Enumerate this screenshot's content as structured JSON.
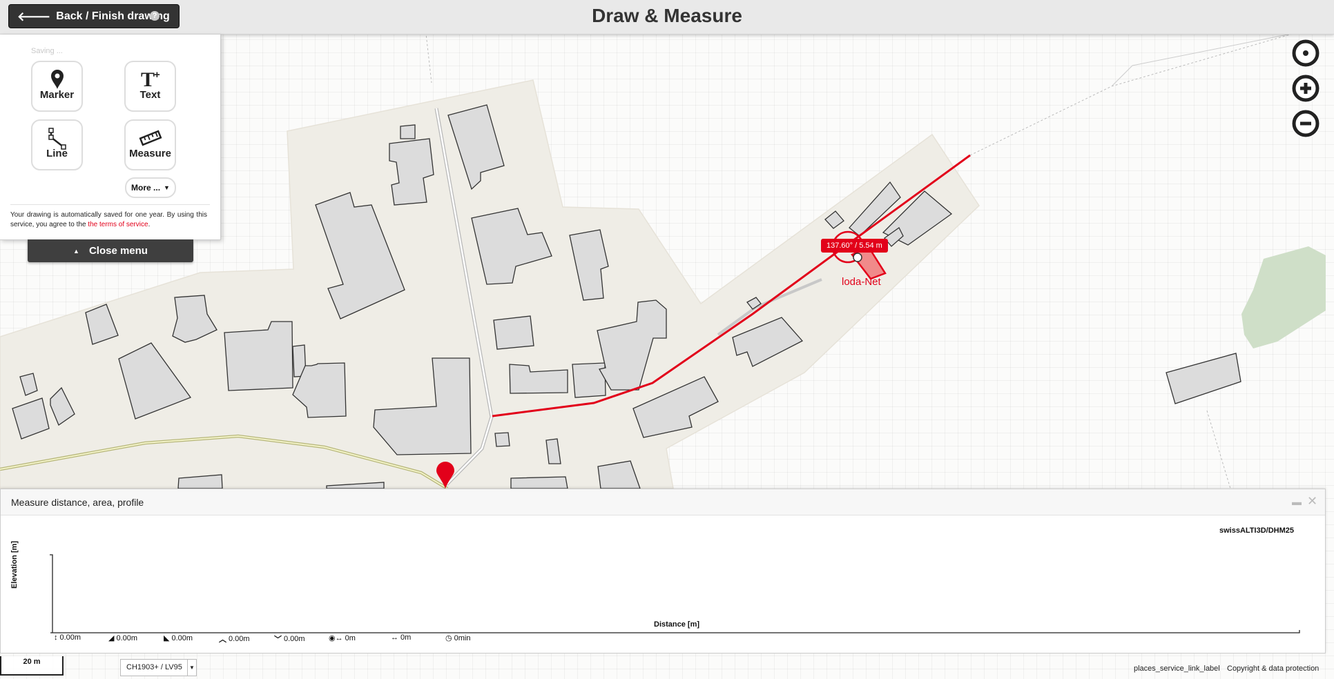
{
  "header": {
    "back_label": "Back / Finish drawing",
    "title": "Draw & Measure",
    "help_icon": "?"
  },
  "draw_menu": {
    "saving": "Saving ...",
    "tools": [
      {
        "label": "Marker",
        "icon": "marker-icon"
      },
      {
        "label": "Text",
        "icon": "text-icon"
      },
      {
        "label": "Line",
        "icon": "line-icon"
      },
      {
        "label": "Measure",
        "icon": "ruler-icon"
      }
    ],
    "more_label": "More ...",
    "note_prefix": "Your drawing is automatically saved for one year. By using this service, you agree to the ",
    "note_link": "the terms of service",
    "note_suffix": ".",
    "close_label": "Close menu"
  },
  "map": {
    "measure_label": "137.60° / 5.54 m",
    "feature_label": "loda-Net",
    "colors": {
      "drawing": "#e2001a",
      "settlement": "#efede6",
      "building": "#dcdcdc",
      "forest": "#cfdfc8",
      "road_yellow": "#c9c98a"
    }
  },
  "profile": {
    "title": "Measure distance, area, profile",
    "source": "swissALTI3D/DHM25",
    "y_label": "Elevation [m]",
    "x_label": "Distance [m]",
    "stats": [
      {
        "icon": "height-diff-icon",
        "value": "0.00m"
      },
      {
        "icon": "ascent-icon",
        "value": "0.00m"
      },
      {
        "icon": "descent-icon",
        "value": "0.00m"
      },
      {
        "icon": "max-elevation-icon",
        "value": "0.00m"
      },
      {
        "icon": "min-elevation-icon",
        "value": "0.00m"
      },
      {
        "icon": "slope-distance-icon",
        "value": "0m"
      },
      {
        "icon": "distance-icon",
        "value": "0m"
      },
      {
        "icon": "hiking-time-icon",
        "value": "0min"
      }
    ]
  },
  "footer": {
    "scale": "20 m",
    "projection": "CH1903+ / LV95",
    "places_link": "places_service_link_label",
    "copyright": "Copyright & data protection"
  }
}
